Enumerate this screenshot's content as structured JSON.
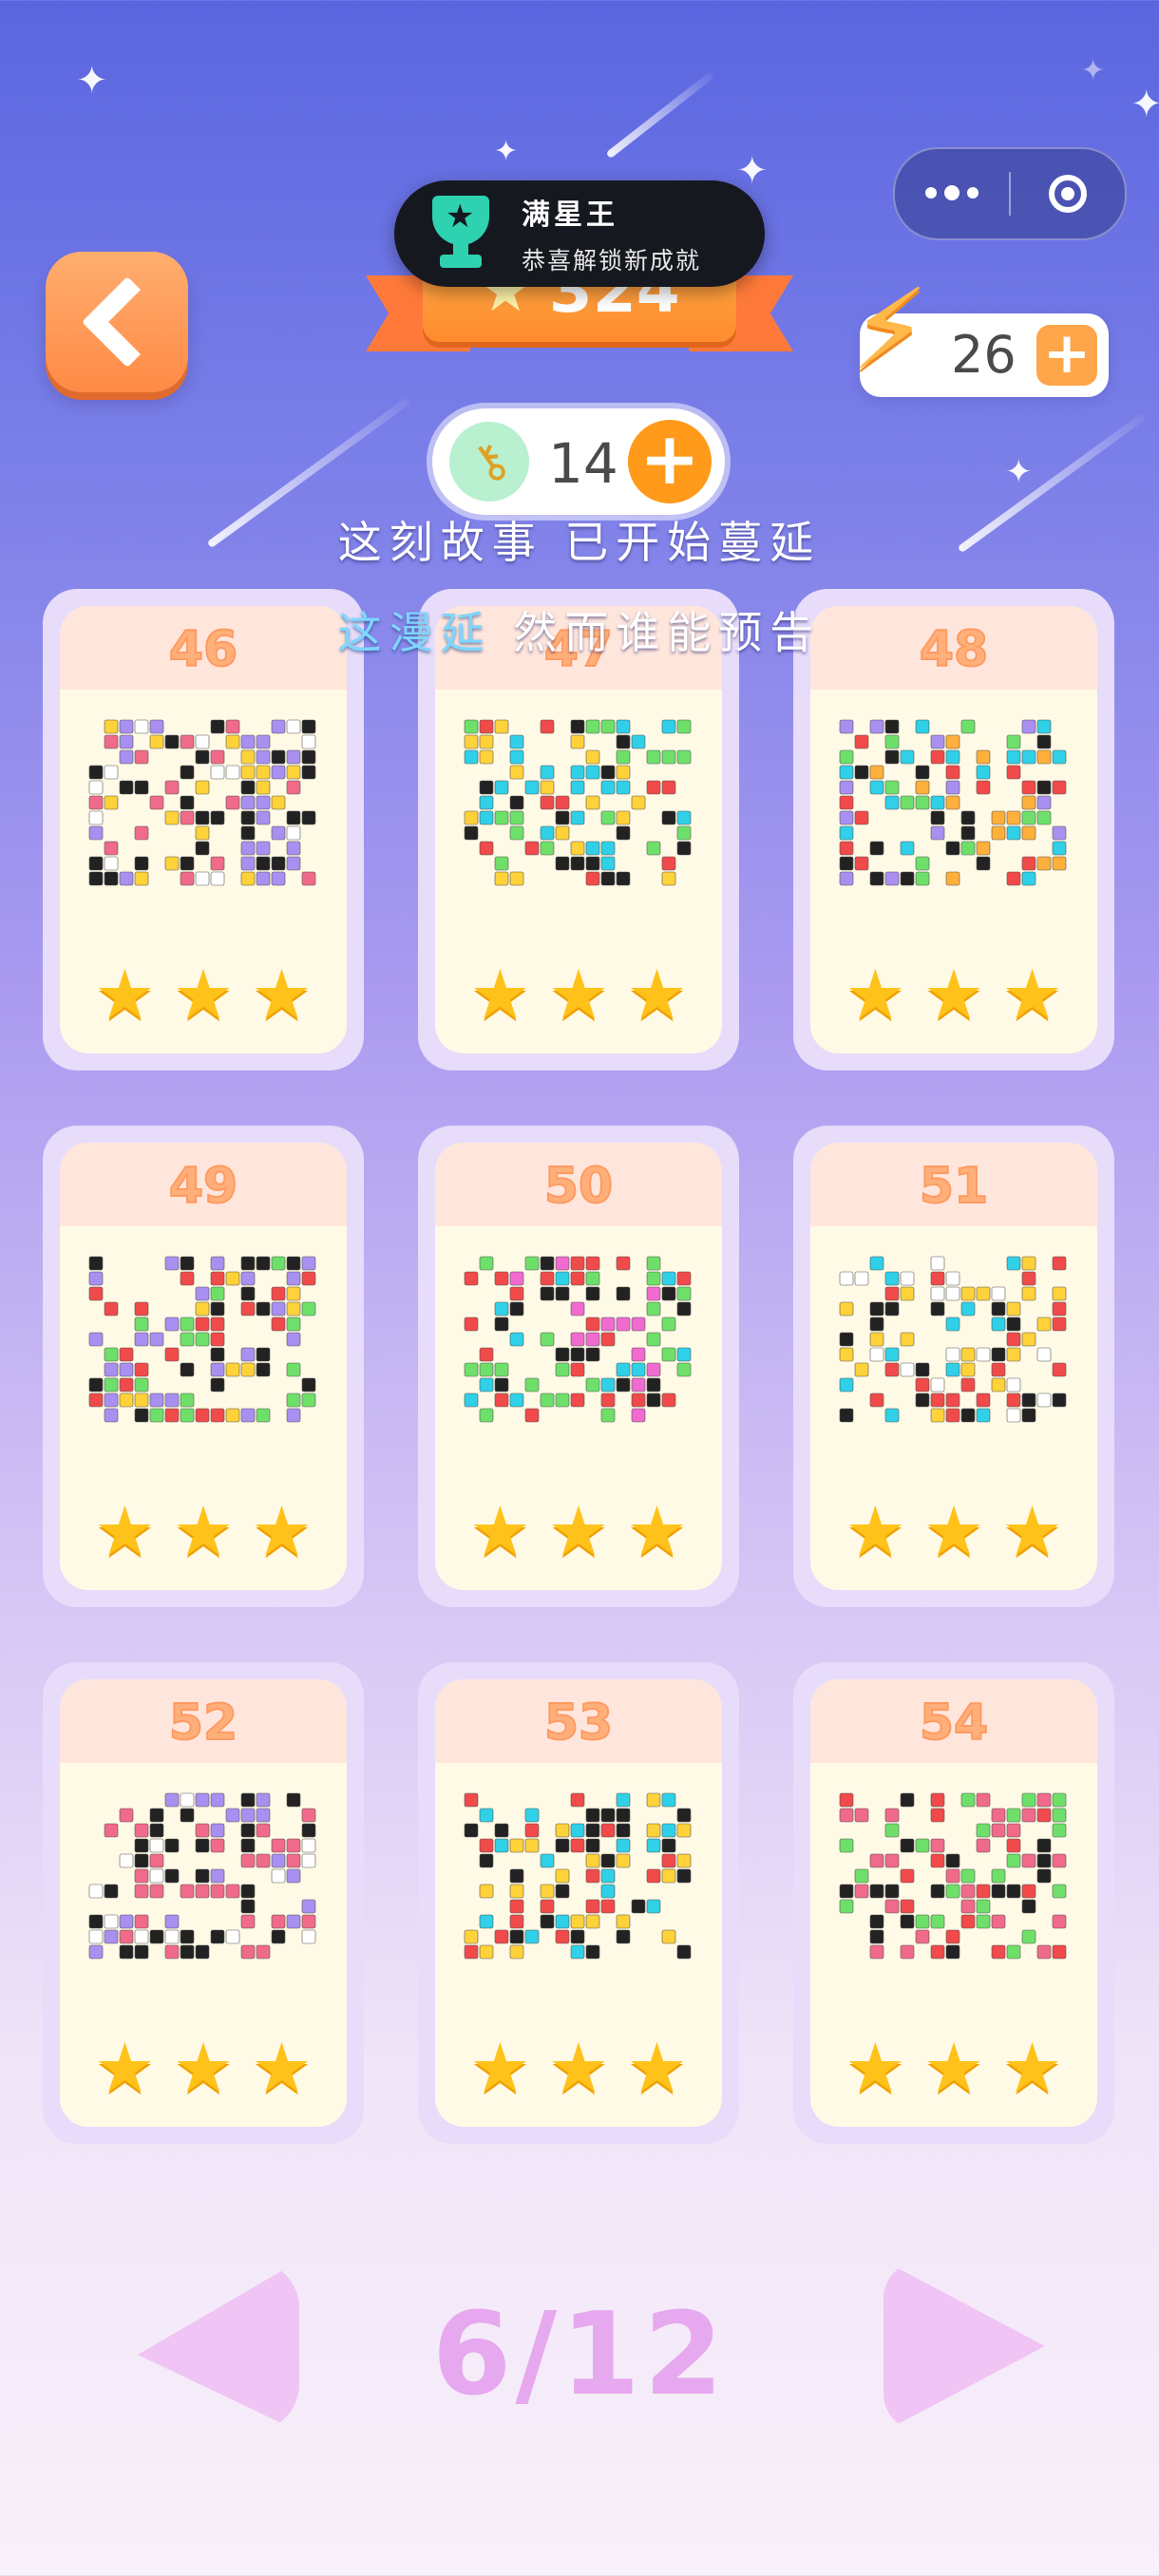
{
  "header": {
    "star_total": "324",
    "energy": "26",
    "keys": "14",
    "plus_label": "+"
  },
  "toast": {
    "title": "满星王",
    "subtitle": "恭喜解锁新成就"
  },
  "lyrics": {
    "line1": "这刻故事 已开始蔓延",
    "line2_highlight": "这漫延",
    "line2_rest": " 然而谁能预告"
  },
  "levels": [
    {
      "number": "46",
      "stars": 3
    },
    {
      "number": "47",
      "stars": 3
    },
    {
      "number": "48",
      "stars": 3
    },
    {
      "number": "49",
      "stars": 3
    },
    {
      "number": "50",
      "stars": 3
    },
    {
      "number": "51",
      "stars": 3
    },
    {
      "number": "52",
      "stars": 3
    },
    {
      "number": "53",
      "stars": 3
    },
    {
      "number": "54",
      "stars": 3
    }
  ],
  "pager": {
    "label": "6/12"
  },
  "colors": {
    "accent_orange": "#ff9a1a",
    "star_gold": "#ffc21a",
    "card_bg": "#fffae6",
    "pager_pink": "#e6a8ee"
  },
  "icons": {
    "back": "chevron-left-icon",
    "trophy": "trophy-icon",
    "energy": "lightning-bolt-icon",
    "key": "key-icon",
    "star": "star-icon"
  }
}
